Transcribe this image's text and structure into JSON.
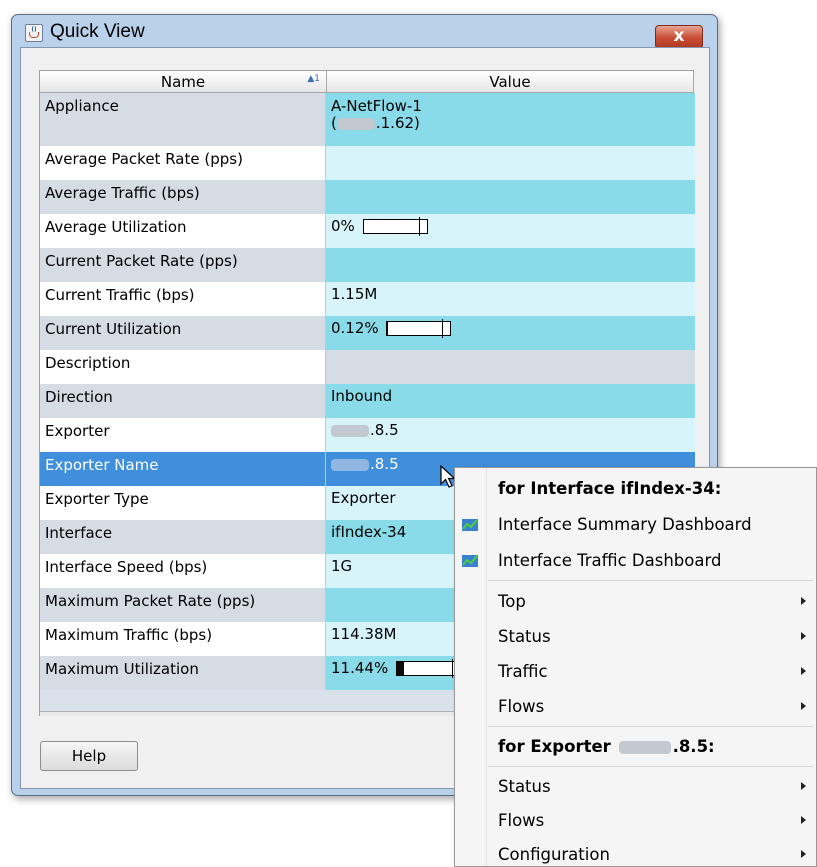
{
  "window": {
    "title": "Quick View",
    "close_glyph": "x"
  },
  "table": {
    "headers": {
      "name": "Name",
      "value": "Value",
      "sort_indicator": "▲1"
    },
    "rows": [
      {
        "name": "Appliance",
        "value_line1": "A-NetFlow-1",
        "value_line2_prefix": "(",
        "value_line2_suffix": ".1.62)"
      },
      {
        "name": "Average Packet Rate (pps)",
        "value": ""
      },
      {
        "name": "Average Traffic (bps)",
        "value": ""
      },
      {
        "name": "Average Utilization",
        "value": "0%",
        "utilization": 0
      },
      {
        "name": "Current Packet Rate (pps)",
        "value": ""
      },
      {
        "name": "Current Traffic (bps)",
        "value": "1.15M"
      },
      {
        "name": "Current Utilization",
        "value": "0.12%",
        "utilization": 0.0012
      },
      {
        "name": "Description",
        "value": ""
      },
      {
        "name": "Direction",
        "value": "Inbound"
      },
      {
        "name": "Exporter",
        "value_suffix": ".8.5"
      },
      {
        "name": "Exporter Name",
        "value_suffix": ".8.5"
      },
      {
        "name": "Exporter Type",
        "value": "Exporter"
      },
      {
        "name": "Interface",
        "value": "ifIndex-34"
      },
      {
        "name": "Interface Speed (bps)",
        "value": "1G"
      },
      {
        "name": "Maximum Packet Rate (pps)",
        "value": ""
      },
      {
        "name": "Maximum Traffic (bps)",
        "value": "114.38M"
      },
      {
        "name": "Maximum Utilization",
        "value": "11.44%",
        "utilization": 0.1144
      }
    ]
  },
  "buttons": {
    "help": "Help"
  },
  "context_menu": {
    "interface_header": "for Interface ifIndex-34:",
    "interface_summary": "Interface Summary Dashboard",
    "interface_traffic": "Interface Traffic Dashboard",
    "top": "Top",
    "status": "Status",
    "traffic": "Traffic",
    "flows": "Flows",
    "exporter_header_prefix": "for Exporter",
    "exporter_header_suffix": ".8.5:",
    "exporter_status": "Status",
    "exporter_flows": "Flows",
    "configuration": "Configuration"
  },
  "colors": {
    "title_bar": "#b9d1ea",
    "row_value_dark": "#8adbe9",
    "row_value_light": "#d7f4fb",
    "selected_row": "#3f8fdc",
    "close_button": "#c74b32"
  },
  "icons": [
    "java-app-icon",
    "close-icon",
    "sort-ascending-icon",
    "dashboard-chart-icon",
    "submenu-arrow-icon",
    "mouse-cursor-icon"
  ]
}
